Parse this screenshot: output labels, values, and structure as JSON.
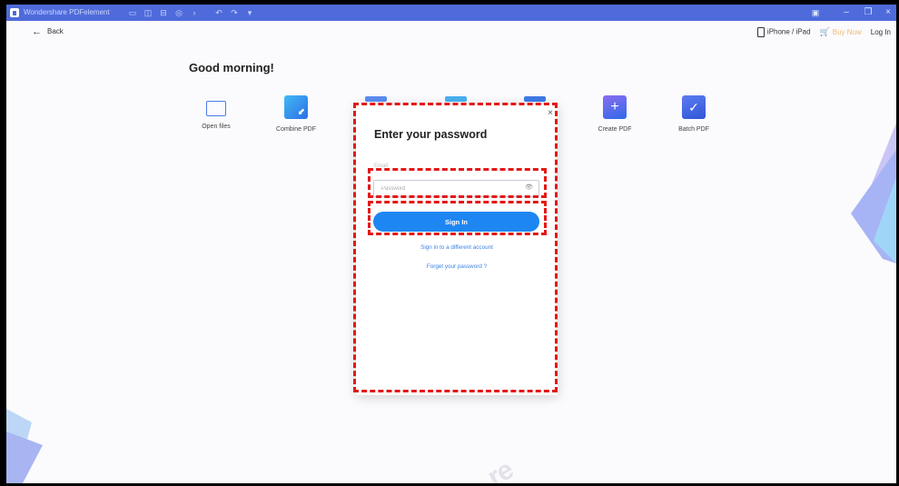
{
  "titlebar": {
    "app_name": "Wondershare PDFelement",
    "icons": [
      "folder-icon",
      "save-icon",
      "print-icon",
      "share-icon",
      "expand-icon",
      "undo-icon",
      "redo-icon",
      "dropdown-icon"
    ],
    "window_controls": [
      "minimize",
      "restore",
      "close"
    ]
  },
  "topbar": {
    "back_label": "Back",
    "iphone_label": "iPhone / iPad",
    "buy_now_label": "Buy Now",
    "login_label": "Log In"
  },
  "greeting": "Good morning!",
  "tiles": [
    {
      "label": "Open files",
      "icon": "folder-icon"
    },
    {
      "label": "Combine PDF",
      "icon": "combine-pdf-icon"
    },
    {
      "label": "Create PDF",
      "icon": "create-pdf-icon"
    },
    {
      "label": "Batch PDF",
      "icon": "batch-pdf-icon"
    }
  ],
  "modal": {
    "title": "Enter your password",
    "email_label": "Email",
    "password_placeholder": "Password",
    "signin_label": "Sign In",
    "different_account_label": "Sign in to a different account",
    "forgot_label": "Forget your password ?",
    "close_glyph": "×"
  },
  "colors": {
    "accent": "#1e86f2",
    "titlebar": "#4f6bdb",
    "highlight_dash": "#e31818",
    "buy_now": "#f08a24"
  },
  "watermark": "re"
}
